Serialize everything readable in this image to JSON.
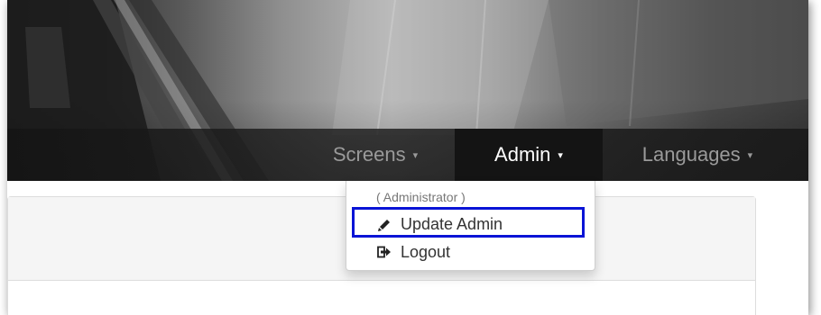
{
  "navbar": {
    "items": [
      {
        "label": "Screens",
        "caret": "▾",
        "active": false
      },
      {
        "label": "Admin",
        "caret": "▾",
        "active": true
      },
      {
        "label": "Languages",
        "caret": "▾",
        "active": false
      }
    ]
  },
  "admin_menu": {
    "header": "( Administrator )",
    "items": [
      {
        "label": "Update Admin",
        "icon": "pencil-icon",
        "highlighted": true
      },
      {
        "label": "Logout",
        "icon": "sign-out-icon",
        "highlighted": false
      }
    ]
  },
  "colors": {
    "highlight_border": "#0a14d6",
    "navbar_bg": "#1e1e1e",
    "active_item_bg": "#141414"
  }
}
